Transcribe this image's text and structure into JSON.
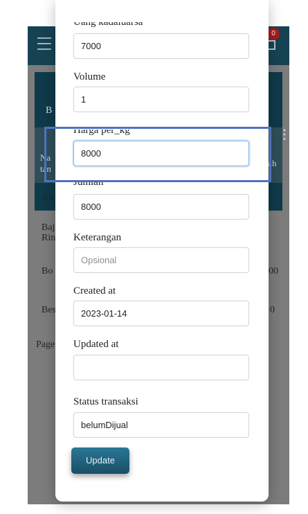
{
  "background": {
    "panel_title_fragment": "B",
    "header_fragment_1": "Na",
    "header_fragment_2": "tan",
    "header_fragment_right": "ılah",
    "rows": [
      {
        "left": "Alt",
        "right": ""
      },
      {
        "left": "Baj",
        "left2": "Rin",
        "right": ""
      },
      {
        "left": "Bo",
        "right": "00"
      },
      {
        "left": "Bes",
        "right": "0"
      },
      {
        "left": "Page",
        "right": ""
      }
    ],
    "notification_count": "0"
  },
  "form": {
    "top_label_partial": "Uang kadaluarsa",
    "uang_value": "7000",
    "volume_label": "Volume",
    "volume_value": "1",
    "harga_label": "Harga per_kg",
    "harga_value": "8000",
    "jumlah_label": "Jumlah",
    "jumlah_value": "8000",
    "keterangan_label": "Keterangan",
    "keterangan_placeholder": "Opsional",
    "created_label": "Created at",
    "created_value": "2023-01-14",
    "updated_label": "Updated at",
    "updated_value": "",
    "status_label": "Status transaksi",
    "status_value": "belumDijual",
    "update_button": "Update"
  }
}
